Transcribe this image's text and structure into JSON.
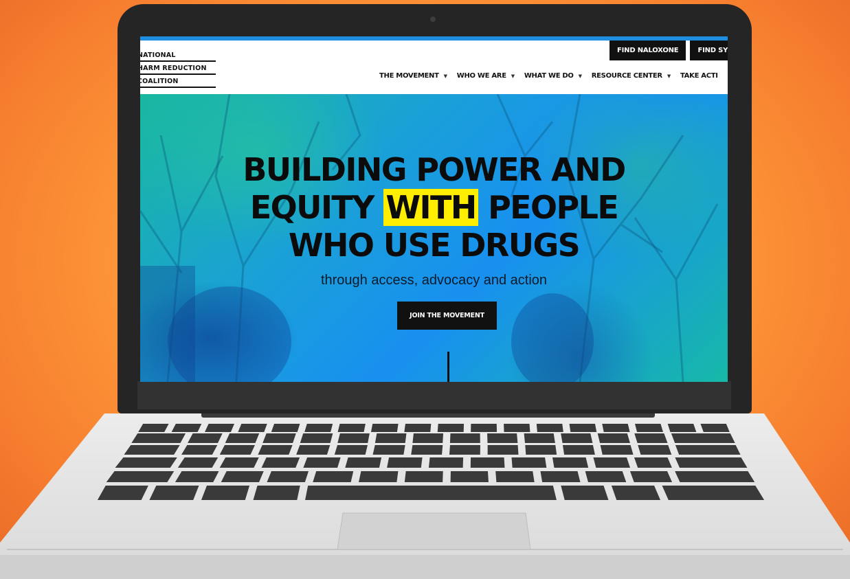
{
  "site": {
    "logo_lines": [
      "NATIONAL",
      "HARM REDUCTION",
      "COALITION"
    ],
    "utility_buttons": [
      "FIND NALOXONE",
      "FIND SY"
    ],
    "nav": [
      {
        "label": "THE MOVEMENT"
      },
      {
        "label": "WHO WE ARE"
      },
      {
        "label": "WHAT WE DO"
      },
      {
        "label": "RESOURCE CENTER"
      },
      {
        "label": "TAKE ACTI"
      }
    ],
    "hero": {
      "headline_line1": "BUILDING POWER AND",
      "headline_line2_pre": "EQUITY ",
      "headline_line2_highlight": "WITH",
      "headline_line2_post": " PEOPLE",
      "headline_line3": "WHO USE DRUGS",
      "subheadline": "through access, advocacy and action",
      "cta_label": "JOIN THE MOVEMENT"
    }
  },
  "colors": {
    "background_orange": "#ff9a3a",
    "highlight_yellow": "#ffee00",
    "top_stripe_blue": "#1e8fe0",
    "hero_teal": "#19b8a0",
    "hero_blue": "#1890f0"
  }
}
